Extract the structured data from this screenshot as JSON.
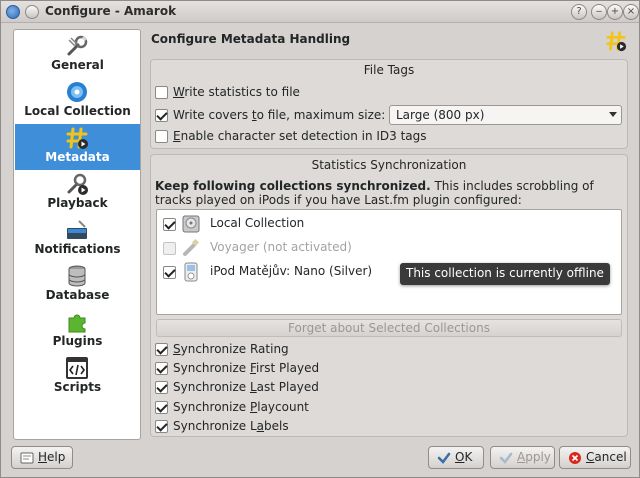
{
  "window": {
    "title": "Configure - Amarok"
  },
  "titlebar": {
    "help_glyph": "?",
    "min_glyph": "‒",
    "max_glyph": "+",
    "close_glyph": "×"
  },
  "sidebar": {
    "items": [
      {
        "label": "General",
        "icon": "wrench-icon",
        "active": false
      },
      {
        "label": "Local Collection",
        "icon": "disc-icon",
        "active": false
      },
      {
        "label": "Metadata",
        "icon": "hash-tag-icon",
        "active": true
      },
      {
        "label": "Playback",
        "icon": "wrench-play-icon",
        "active": false
      },
      {
        "label": "Notifications",
        "icon": "notification-icon",
        "active": false
      },
      {
        "label": "Database",
        "icon": "database-icon",
        "active": false
      },
      {
        "label": "Plugins",
        "icon": "puzzle-icon",
        "active": false
      },
      {
        "label": "Scripts",
        "icon": "script-icon",
        "active": false
      }
    ]
  },
  "main": {
    "title": "Configure Metadata Handling",
    "file_tags": {
      "title": "File Tags",
      "write_statistics": {
        "pre": "",
        "u": "W",
        "post": "rite statistics to file",
        "checked": false
      },
      "write_covers": {
        "pre": "Write covers ",
        "u": "t",
        "post": "o file, maximum size:",
        "checked": true
      },
      "cover_size": "Large (800 px)",
      "charset_detection": {
        "pre": "",
        "u": "E",
        "post": "nable character set detection in ID3 tags",
        "checked": false
      }
    },
    "stats_sync": {
      "title": "Statistics Synchronization",
      "desc_bold": "Keep following collections synchronized.",
      "desc_rest": " This includes scrobbling of tracks played on iPods if you have Last.fm plugin configured:",
      "collections": [
        {
          "name": "Local Collection",
          "checked": true,
          "enabled": true,
          "icon": "drive-icon"
        },
        {
          "name": "Voyager (not activated)",
          "checked": false,
          "enabled": false,
          "icon": "usb-icon"
        },
        {
          "name": "iPod Matějův: Nano (Silver)",
          "checked": true,
          "enabled": true,
          "icon": "ipod-icon"
        }
      ],
      "tooltip": "This collection is currently offline",
      "forget_button": "Forget about Selected Collections",
      "options": [
        {
          "pre": "",
          "u": "S",
          "post": "ynchronize Rating",
          "checked": true
        },
        {
          "pre": "Synchronize ",
          "u": "F",
          "post": "irst Played",
          "checked": true
        },
        {
          "pre": "Synchronize ",
          "u": "L",
          "post": "ast Played",
          "checked": true
        },
        {
          "pre": "Synchronize ",
          "u": "P",
          "post": "laycount",
          "checked": true
        },
        {
          "pre": "Synchronize L",
          "u": "a",
          "post": "bels",
          "checked": true
        }
      ]
    }
  },
  "buttons": {
    "help": {
      "pre": "",
      "u": "H",
      "post": "elp"
    },
    "ok": {
      "pre": "",
      "u": "O",
      "post": "K"
    },
    "apply": {
      "pre": "",
      "u": "A",
      "post": "pply"
    },
    "cancel": {
      "pre": "",
      "u": "C",
      "post": "ancel"
    }
  },
  "colors": {
    "selection": "#3f8ed9",
    "window_bg": "#d6d2d0"
  }
}
